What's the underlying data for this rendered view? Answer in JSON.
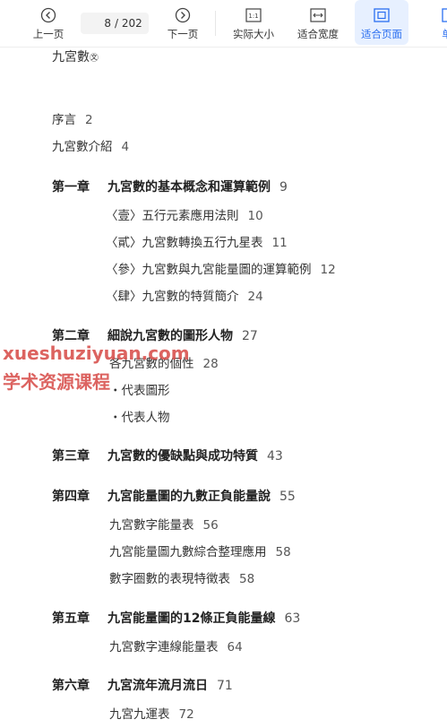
{
  "toolbar": {
    "prev_label": "上一页",
    "page_current": "8",
    "page_total": "/ 202",
    "next_label": "下一页",
    "actual_size_label": "实际大小",
    "fit_width_label": "适合宽度",
    "fit_page_label": "适合页面",
    "extra_label": "单",
    "accent_color": "#2b6ff0"
  },
  "document": {
    "partial_heading": "九宮數",
    "front_items": [
      {
        "title": "序言",
        "page": "2"
      },
      {
        "title": "九宮數介紹",
        "page": "4"
      }
    ],
    "chapters": [
      {
        "num": "第一章",
        "title": "九宮數的基本概念和運算範例",
        "page": "9",
        "items": [
          {
            "title": "〈壹〉五行元素應用法則",
            "page": "10"
          },
          {
            "title": "〈貳〉九宮數轉換五行九星表",
            "page": "11"
          },
          {
            "title": "〈參〉九宮數與九宮能量圖的運算範例",
            "page": "12"
          },
          {
            "title": "〈肆〉九宮數的特質簡介",
            "page": "24"
          }
        ]
      },
      {
        "num": "第二章",
        "title": "細說九宮數的圖形人物",
        "page": "27",
        "items": [
          {
            "title": "各九宮數的個性",
            "page": "28"
          },
          {
            "title": "・代表圖形",
            "page": ""
          },
          {
            "title": "・代表人物",
            "page": ""
          }
        ]
      },
      {
        "num": "第三章",
        "title": "九宮數的優缺點與成功特質",
        "page": "43",
        "items": []
      },
      {
        "num": "第四章",
        "title": "九宮能量圖的九數正負能量說",
        "page": "55",
        "items": [
          {
            "title": "九宮數字能量表",
            "page": "56"
          },
          {
            "title": "九宮能量圖九數綜合整理應用",
            "page": "58"
          },
          {
            "title": "數字圈數的表現特徵表",
            "page": "58"
          }
        ]
      },
      {
        "num": "第五章",
        "title": "九宮能量圖的12條正負能量線",
        "page": "63",
        "items": [
          {
            "title": "九宮數字連線能量表",
            "page": "64"
          }
        ]
      },
      {
        "num": "第六章",
        "title": "九宮流年流月流日",
        "page": "71",
        "items": [
          {
            "title": "九宮九運表",
            "page": "72"
          }
        ]
      }
    ],
    "watermark_line1": "xueshuziyuan.com",
    "watermark_line2": "学术资源课程"
  }
}
